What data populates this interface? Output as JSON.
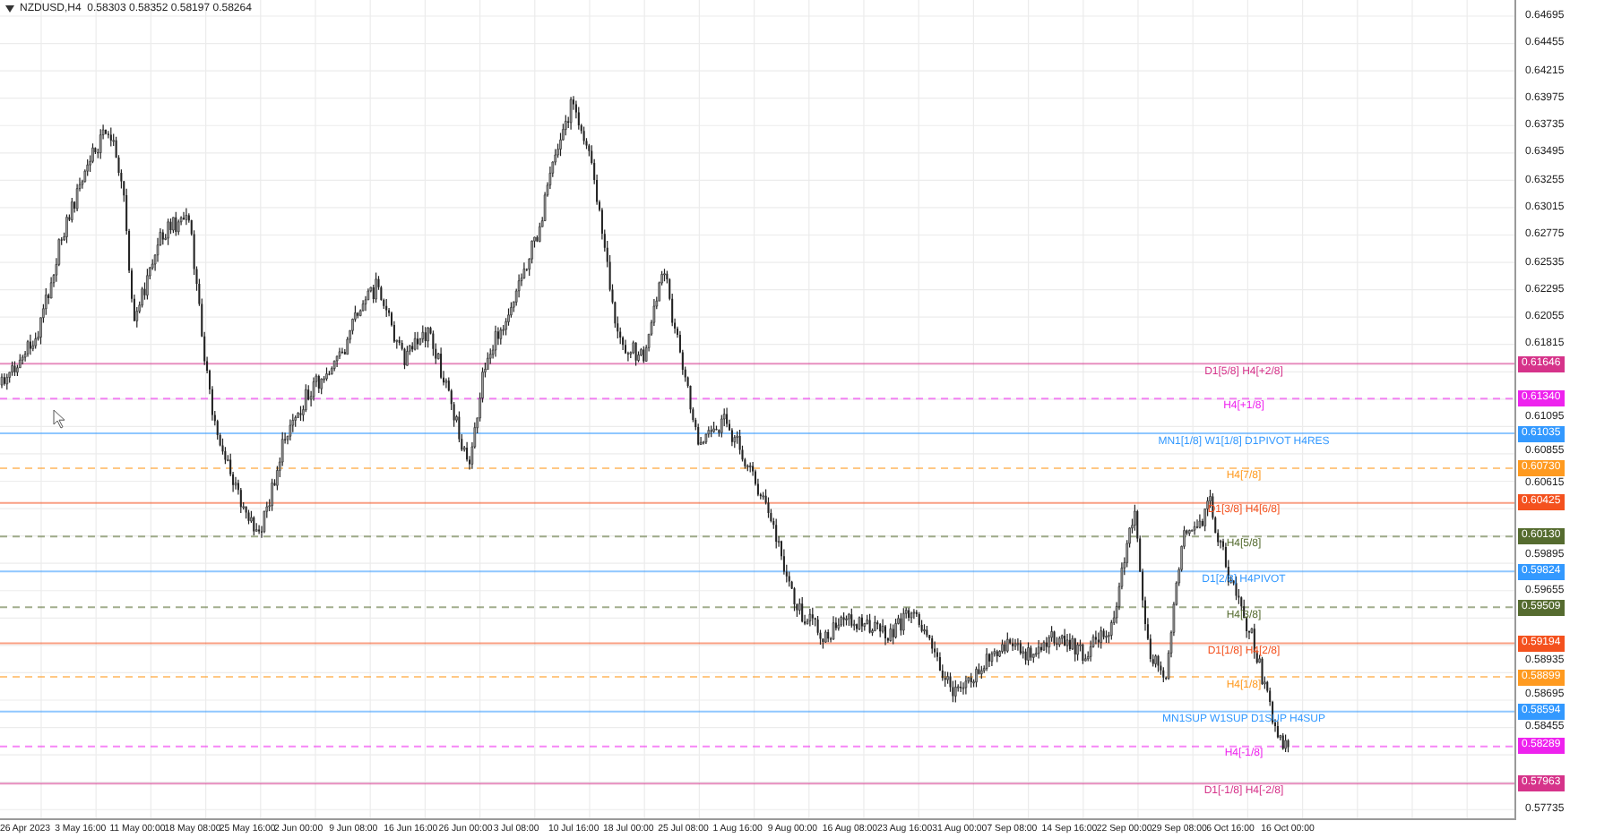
{
  "chart": {
    "header": "NZDUSD,H4  0.58303 0.58352 0.58197 0.58264",
    "price_labels": [
      "0.64695",
      "0.64455",
      "0.64215",
      "0.63975",
      "0.63735",
      "0.63495",
      "0.63255",
      "0.63015",
      "0.62775",
      "0.62535",
      "0.62295",
      "0.62055",
      "0.61815",
      "0.61095",
      "0.60855",
      "0.60615",
      "0.59895",
      "0.59655",
      "0.58935",
      "0.58695",
      "0.58455",
      "0.57735"
    ],
    "levels": [
      {
        "label": "D1[5/8] H4[+2/8]",
        "price": "0.61646",
        "color": "#d6338a",
        "kind": "solid"
      },
      {
        "label": "H4[+1/8]",
        "price": "0.61340",
        "color": "#ee22ee",
        "kind": "dashed"
      },
      {
        "label": "MN1[1/8] W1[1/8] D1PIVOT H4RES",
        "price": "0.61035",
        "color": "#3399ff",
        "kind": "solid"
      },
      {
        "label": "H4[7/8]",
        "price": "0.60730",
        "color": "#ff9a1f",
        "kind": "dashed"
      },
      {
        "label": "D1[3/8] H4[6/8]",
        "price": "0.60425",
        "color": "#f4511e",
        "kind": "solid"
      },
      {
        "label": "H4[5/8]",
        "price": "0.60130",
        "color": "#556b2f",
        "kind": "dashed"
      },
      {
        "label": "D1[2/8] H4PIVOT",
        "price": "0.59824",
        "color": "#3399ff",
        "kind": "solid"
      },
      {
        "label": "H4[3/8]",
        "price": "0.59509",
        "color": "#556b2f",
        "kind": "dashed"
      },
      {
        "label": "D1[1/8] H4[2/8]",
        "price": "0.59194",
        "color": "#f4511e",
        "kind": "solid"
      },
      {
        "label": "H4[1/8]",
        "price": "0.58899",
        "color": "#ff9a1f",
        "kind": "dashed"
      },
      {
        "label": "MN1SUP W1SUP D1SUP H4SUP",
        "price": "0.58594",
        "color": "#3399ff",
        "kind": "solid"
      },
      {
        "label": "H4[-1/8]",
        "price": "0.58289",
        "color": "#ee22ee",
        "kind": "dashed"
      },
      {
        "label": "D1[-1/8] H4[-2/8]",
        "price": "0.57963",
        "color": "#d6338a",
        "kind": "solid"
      }
    ],
    "time_labels": [
      "26 Apr 2023",
      "3 May 16:00",
      "11 May 00:00",
      "18 May 08:00",
      "25 May 16:00",
      "2 Jun 00:00",
      "9 Jun 08:00",
      "16 Jun 16:00",
      "26 Jun 00:00",
      "3 Jul 08:00",
      "10 Jul 16:00",
      "18 Jul 00:00",
      "25 Jul 08:00",
      "1 Aug 16:00",
      "9 Aug 00:00",
      "16 Aug 08:00",
      "23 Aug 16:00",
      "31 Aug 00:00",
      "7 Sep 08:00",
      "14 Sep 16:00",
      "22 Sep 00:00",
      "29 Sep 08:00",
      "6 Oct 16:00",
      "16 Oct 00:00"
    ]
  }
}
